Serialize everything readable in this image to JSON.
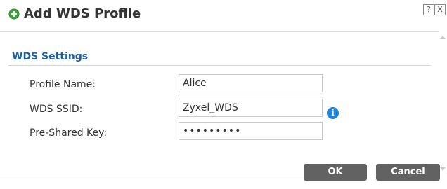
{
  "dialog": {
    "title": "Add WDS Profile",
    "help_label": "?",
    "close_label": "X"
  },
  "section": {
    "title": "WDS Settings"
  },
  "fields": {
    "profile_name": {
      "label": "Profile Name:",
      "value": "Alice"
    },
    "wds_ssid": {
      "label": "WDS SSID:",
      "value": "Zyxel_WDS"
    },
    "pre_shared_key": {
      "label": "Pre-Shared Key:",
      "value": "•••••••••"
    }
  },
  "info_icon_glyph": "i",
  "buttons": {
    "ok": "OK",
    "cancel": "Cancel"
  },
  "colors": {
    "accent_blue": "#1b5fa6",
    "info_blue": "#1f86e0",
    "add_icon_green": "#3f9e3f",
    "button_gray": "#626262"
  },
  "icons": {
    "title": "add-circle-icon",
    "info": "info-icon"
  }
}
